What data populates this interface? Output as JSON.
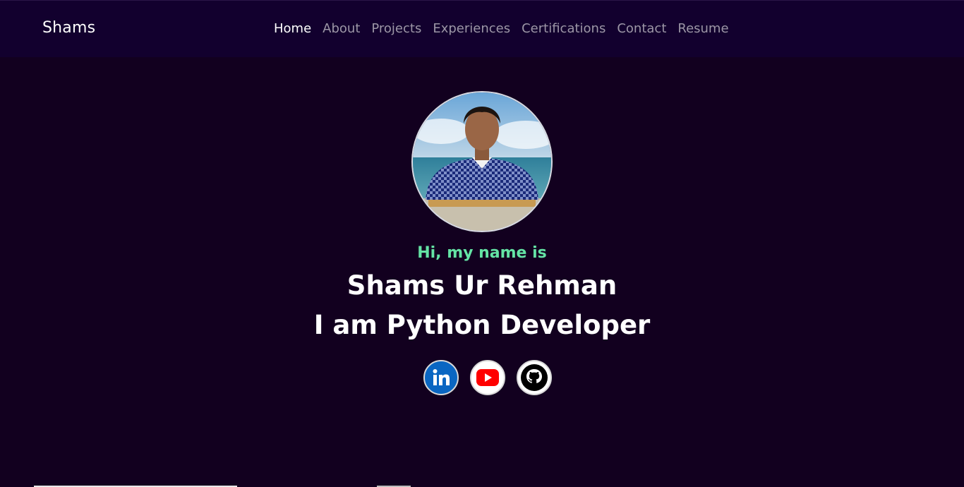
{
  "brand": "Shams",
  "nav": {
    "items": [
      {
        "label": "Home",
        "active": true
      },
      {
        "label": "About",
        "active": false
      },
      {
        "label": "Projects",
        "active": false
      },
      {
        "label": "Experiences",
        "active": false
      },
      {
        "label": "Certifications",
        "active": false
      },
      {
        "label": "Contact",
        "active": false
      },
      {
        "label": "Resume",
        "active": false
      }
    ]
  },
  "hero": {
    "greeting": "Hi, my name is",
    "name": "Shams Ur Rehman",
    "role": "I am Python Developer"
  },
  "socials": [
    {
      "icon": "linkedin-icon",
      "color": "#0a66c2"
    },
    {
      "icon": "youtube-icon",
      "color": "#ff0000"
    },
    {
      "icon": "github-icon",
      "color": "#000000"
    }
  ],
  "colors": {
    "background": "#12001f",
    "navbar": "#12002e",
    "accent": "#64e4a5",
    "nav_inactive": "#9c96a6"
  }
}
